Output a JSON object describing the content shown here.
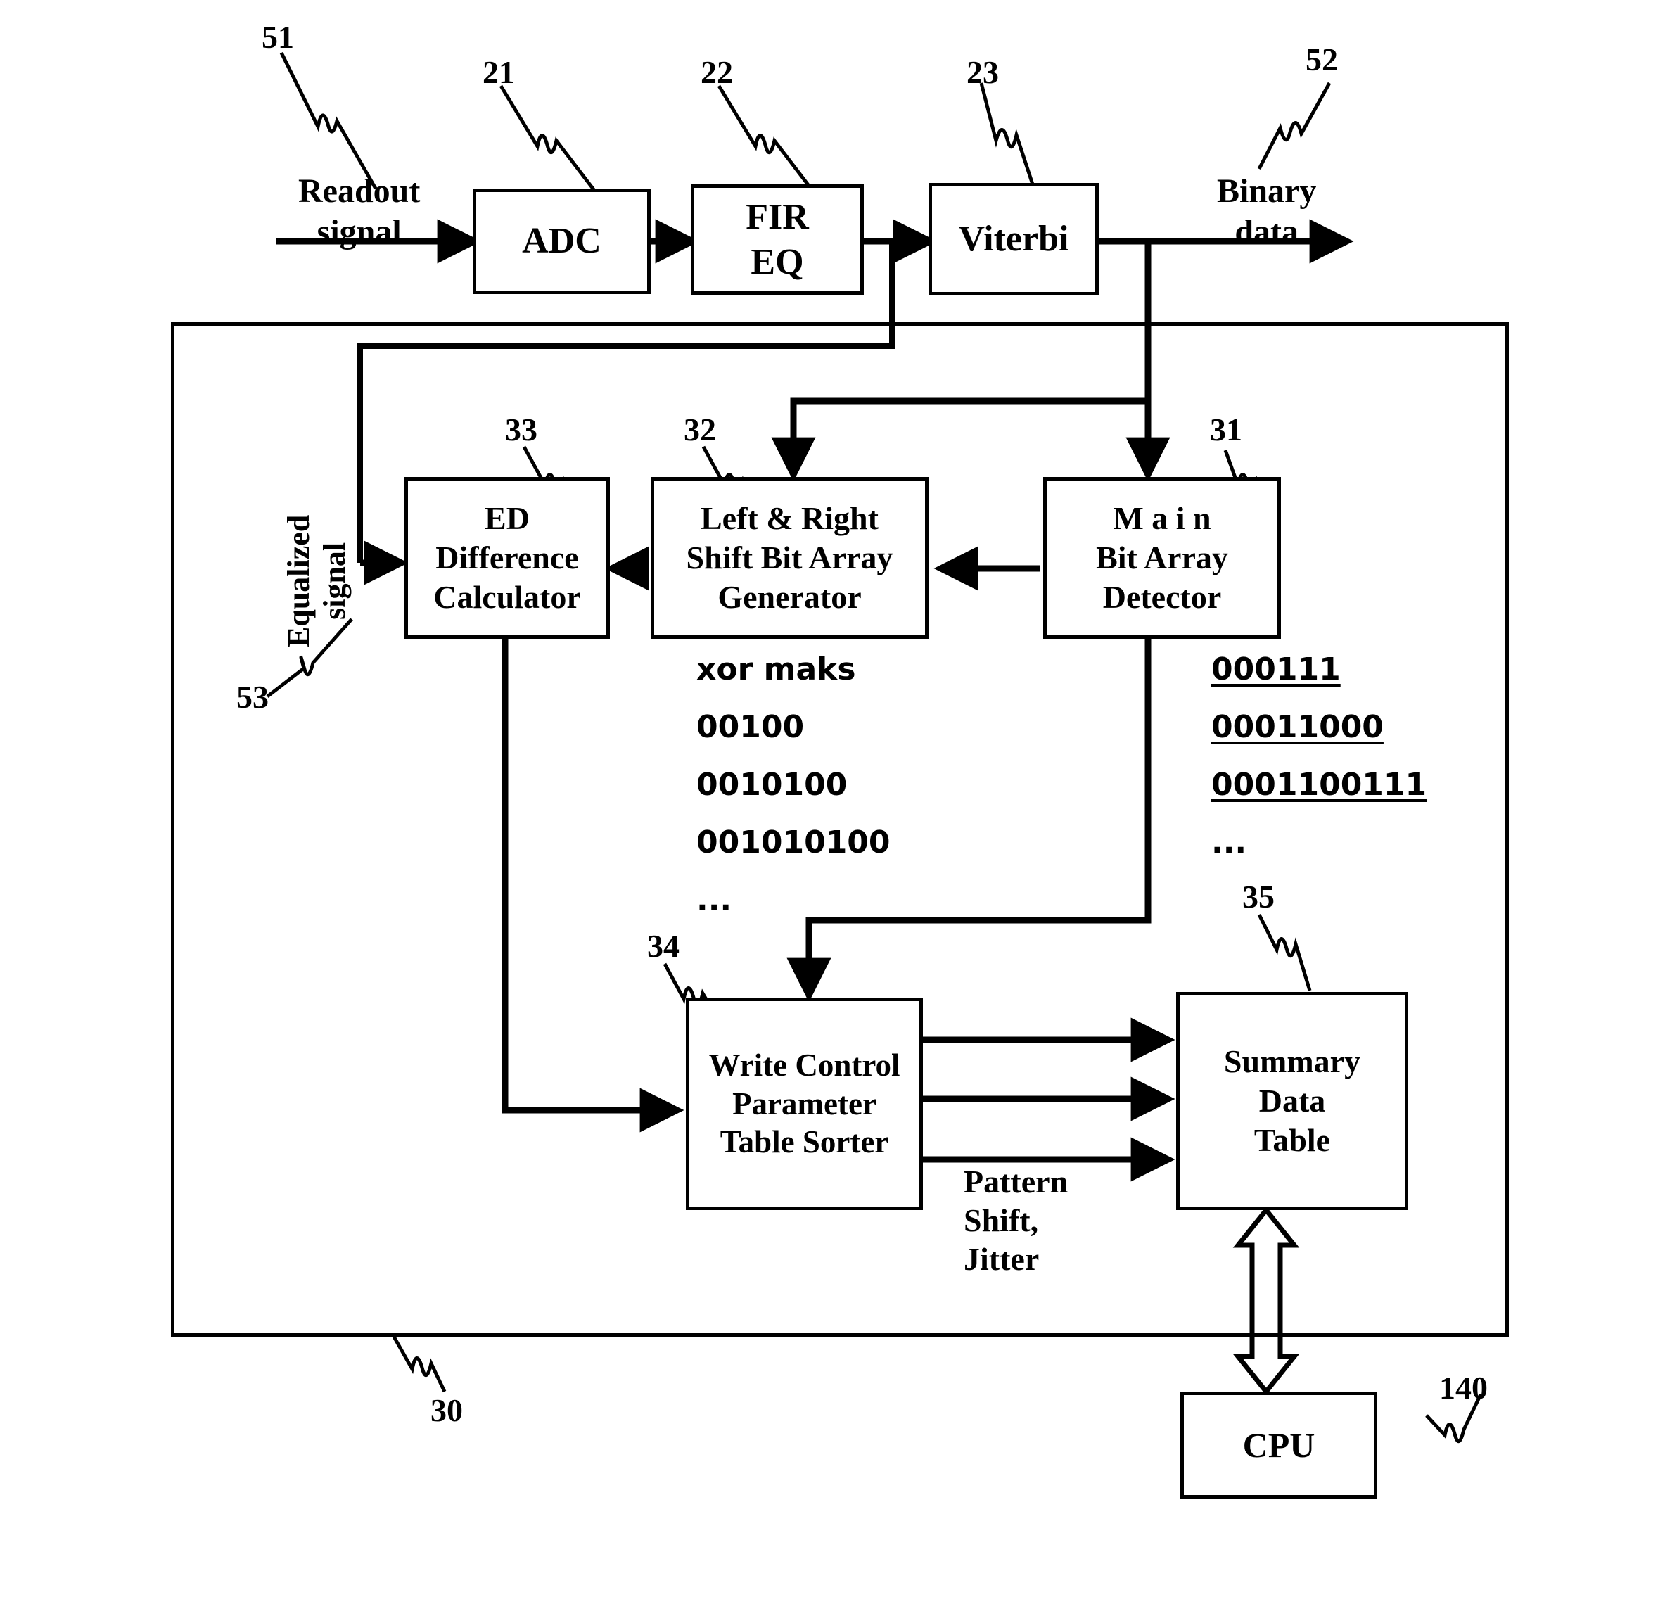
{
  "figure": {
    "title": "Readout signal processing and write control parameter block diagram",
    "stroke_color": "#000000",
    "background_color": "#ffffff"
  },
  "signals": {
    "readout_signal": "Readout\nsignal",
    "binary_data": "Binary\ndata",
    "equalized_signal": "Equalized\nsignal",
    "pattern_shift_jitter": "Pattern\nShift,\nJitter"
  },
  "blocks": {
    "adc": "ADC",
    "fir_eq": "FIR\nEQ",
    "viterbi": "Viterbi",
    "ed_difference_calculator": "ED\nDifference\nCalculator",
    "left_right_shift_bit_array_generator": "Left & Right\nShift Bit Array\nGenerator",
    "main_bit_array_detector": "M a i n\nBit Array\nDetector",
    "write_control_parameter_table_sorter": "Write Control\nParameter\nTable Sorter",
    "summary_data_table": "Summary\nData\nTable",
    "cpu": "CPU"
  },
  "reference_numerals": {
    "r51": "51",
    "r52": "52",
    "r53": "53",
    "r21": "21",
    "r22": "22",
    "r23": "23",
    "r30": "30",
    "r31": "31",
    "r32": "32",
    "r33": "33",
    "r34": "34",
    "r35": "35",
    "r140": "140"
  },
  "xor_mask_list": {
    "heading": "xor maks",
    "items": [
      "00100",
      "0010100",
      "001010100",
      "..."
    ]
  },
  "main_bit_array_list": {
    "items": [
      "000111",
      "00011000",
      "0001100111"
    ],
    "ellipsis": "..."
  }
}
